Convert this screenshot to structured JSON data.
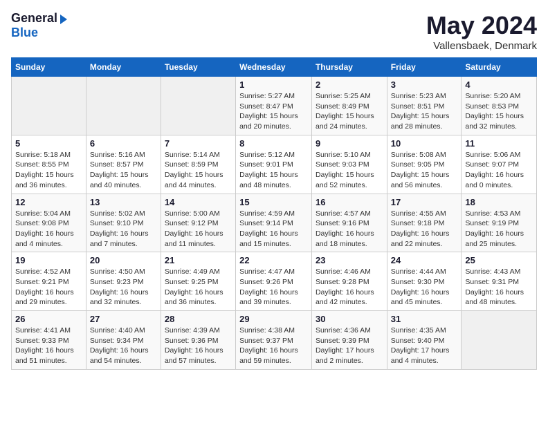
{
  "logo": {
    "general": "General",
    "blue": "Blue"
  },
  "header": {
    "title": "May 2024",
    "location": "Vallensbaek, Denmark"
  },
  "weekdays": [
    "Sunday",
    "Monday",
    "Tuesday",
    "Wednesday",
    "Thursday",
    "Friday",
    "Saturday"
  ],
  "weeks": [
    [
      {
        "day": "",
        "info": ""
      },
      {
        "day": "",
        "info": ""
      },
      {
        "day": "",
        "info": ""
      },
      {
        "day": "1",
        "info": "Sunrise: 5:27 AM\nSunset: 8:47 PM\nDaylight: 15 hours\nand 20 minutes."
      },
      {
        "day": "2",
        "info": "Sunrise: 5:25 AM\nSunset: 8:49 PM\nDaylight: 15 hours\nand 24 minutes."
      },
      {
        "day": "3",
        "info": "Sunrise: 5:23 AM\nSunset: 8:51 PM\nDaylight: 15 hours\nand 28 minutes."
      },
      {
        "day": "4",
        "info": "Sunrise: 5:20 AM\nSunset: 8:53 PM\nDaylight: 15 hours\nand 32 minutes."
      }
    ],
    [
      {
        "day": "5",
        "info": "Sunrise: 5:18 AM\nSunset: 8:55 PM\nDaylight: 15 hours\nand 36 minutes."
      },
      {
        "day": "6",
        "info": "Sunrise: 5:16 AM\nSunset: 8:57 PM\nDaylight: 15 hours\nand 40 minutes."
      },
      {
        "day": "7",
        "info": "Sunrise: 5:14 AM\nSunset: 8:59 PM\nDaylight: 15 hours\nand 44 minutes."
      },
      {
        "day": "8",
        "info": "Sunrise: 5:12 AM\nSunset: 9:01 PM\nDaylight: 15 hours\nand 48 minutes."
      },
      {
        "day": "9",
        "info": "Sunrise: 5:10 AM\nSunset: 9:03 PM\nDaylight: 15 hours\nand 52 minutes."
      },
      {
        "day": "10",
        "info": "Sunrise: 5:08 AM\nSunset: 9:05 PM\nDaylight: 15 hours\nand 56 minutes."
      },
      {
        "day": "11",
        "info": "Sunrise: 5:06 AM\nSunset: 9:07 PM\nDaylight: 16 hours\nand 0 minutes."
      }
    ],
    [
      {
        "day": "12",
        "info": "Sunrise: 5:04 AM\nSunset: 9:08 PM\nDaylight: 16 hours\nand 4 minutes."
      },
      {
        "day": "13",
        "info": "Sunrise: 5:02 AM\nSunset: 9:10 PM\nDaylight: 16 hours\nand 7 minutes."
      },
      {
        "day": "14",
        "info": "Sunrise: 5:00 AM\nSunset: 9:12 PM\nDaylight: 16 hours\nand 11 minutes."
      },
      {
        "day": "15",
        "info": "Sunrise: 4:59 AM\nSunset: 9:14 PM\nDaylight: 16 hours\nand 15 minutes."
      },
      {
        "day": "16",
        "info": "Sunrise: 4:57 AM\nSunset: 9:16 PM\nDaylight: 16 hours\nand 18 minutes."
      },
      {
        "day": "17",
        "info": "Sunrise: 4:55 AM\nSunset: 9:18 PM\nDaylight: 16 hours\nand 22 minutes."
      },
      {
        "day": "18",
        "info": "Sunrise: 4:53 AM\nSunset: 9:19 PM\nDaylight: 16 hours\nand 25 minutes."
      }
    ],
    [
      {
        "day": "19",
        "info": "Sunrise: 4:52 AM\nSunset: 9:21 PM\nDaylight: 16 hours\nand 29 minutes."
      },
      {
        "day": "20",
        "info": "Sunrise: 4:50 AM\nSunset: 9:23 PM\nDaylight: 16 hours\nand 32 minutes."
      },
      {
        "day": "21",
        "info": "Sunrise: 4:49 AM\nSunset: 9:25 PM\nDaylight: 16 hours\nand 36 minutes."
      },
      {
        "day": "22",
        "info": "Sunrise: 4:47 AM\nSunset: 9:26 PM\nDaylight: 16 hours\nand 39 minutes."
      },
      {
        "day": "23",
        "info": "Sunrise: 4:46 AM\nSunset: 9:28 PM\nDaylight: 16 hours\nand 42 minutes."
      },
      {
        "day": "24",
        "info": "Sunrise: 4:44 AM\nSunset: 9:30 PM\nDaylight: 16 hours\nand 45 minutes."
      },
      {
        "day": "25",
        "info": "Sunrise: 4:43 AM\nSunset: 9:31 PM\nDaylight: 16 hours\nand 48 minutes."
      }
    ],
    [
      {
        "day": "26",
        "info": "Sunrise: 4:41 AM\nSunset: 9:33 PM\nDaylight: 16 hours\nand 51 minutes."
      },
      {
        "day": "27",
        "info": "Sunrise: 4:40 AM\nSunset: 9:34 PM\nDaylight: 16 hours\nand 54 minutes."
      },
      {
        "day": "28",
        "info": "Sunrise: 4:39 AM\nSunset: 9:36 PM\nDaylight: 16 hours\nand 57 minutes."
      },
      {
        "day": "29",
        "info": "Sunrise: 4:38 AM\nSunset: 9:37 PM\nDaylight: 16 hours\nand 59 minutes."
      },
      {
        "day": "30",
        "info": "Sunrise: 4:36 AM\nSunset: 9:39 PM\nDaylight: 17 hours\nand 2 minutes."
      },
      {
        "day": "31",
        "info": "Sunrise: 4:35 AM\nSunset: 9:40 PM\nDaylight: 17 hours\nand 4 minutes."
      },
      {
        "day": "",
        "info": ""
      }
    ]
  ]
}
